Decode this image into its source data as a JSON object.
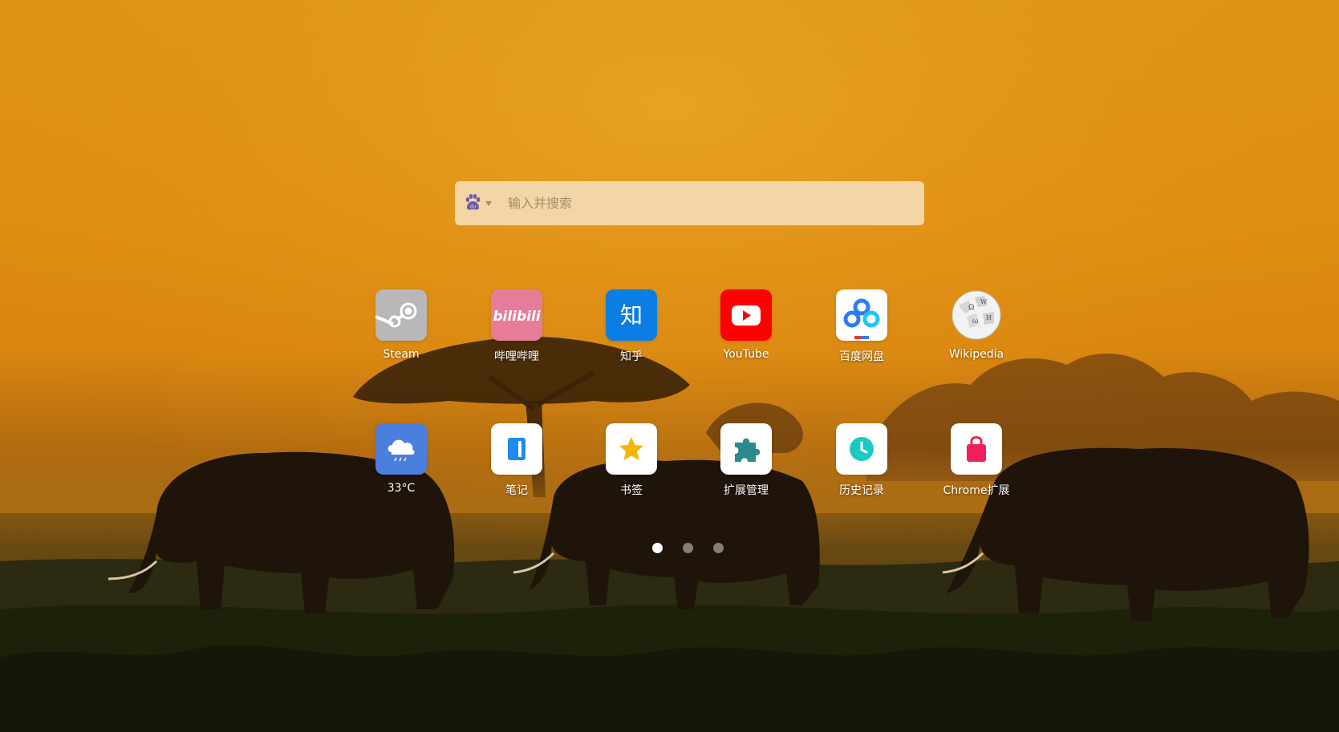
{
  "search": {
    "placeholder": "输入并搜索",
    "engine_icon": "baidu-paw-icon"
  },
  "shortcuts": [
    {
      "label": "Steam",
      "icon": "steam-icon",
      "color": "#b5b5b5"
    },
    {
      "label": "哔哩哔哩",
      "icon": "bilibili-icon",
      "color": "#e77c99"
    },
    {
      "label": "知乎",
      "icon": "zhihu-icon",
      "color": "#0a7ee2",
      "glyph": "知"
    },
    {
      "label": "YouTube",
      "icon": "youtube-icon",
      "color": "#ff0000"
    },
    {
      "label": "百度网盘",
      "icon": "baidu-netdisk-icon",
      "color": "#ffffff"
    },
    {
      "label": "Wikipedia",
      "icon": "wikipedia-globe-icon",
      "color": "#ffffff"
    },
    {
      "label": "33°C",
      "icon": "weather-cloud-icon",
      "color": "#4b7fde"
    },
    {
      "label": "笔记",
      "icon": "notes-icon",
      "color": "#ffffff"
    },
    {
      "label": "书签",
      "icon": "bookmark-star-icon",
      "color": "#ffffff"
    },
    {
      "label": "扩展管理",
      "icon": "puzzle-extension-icon",
      "color": "#ffffff"
    },
    {
      "label": "历史记录",
      "icon": "history-clock-icon",
      "color": "#ffffff"
    },
    {
      "label": "Chrome扩展",
      "icon": "chrome-store-bag-icon",
      "color": "#ffffff"
    }
  ],
  "pagination": {
    "pages": 3,
    "active": 1
  }
}
